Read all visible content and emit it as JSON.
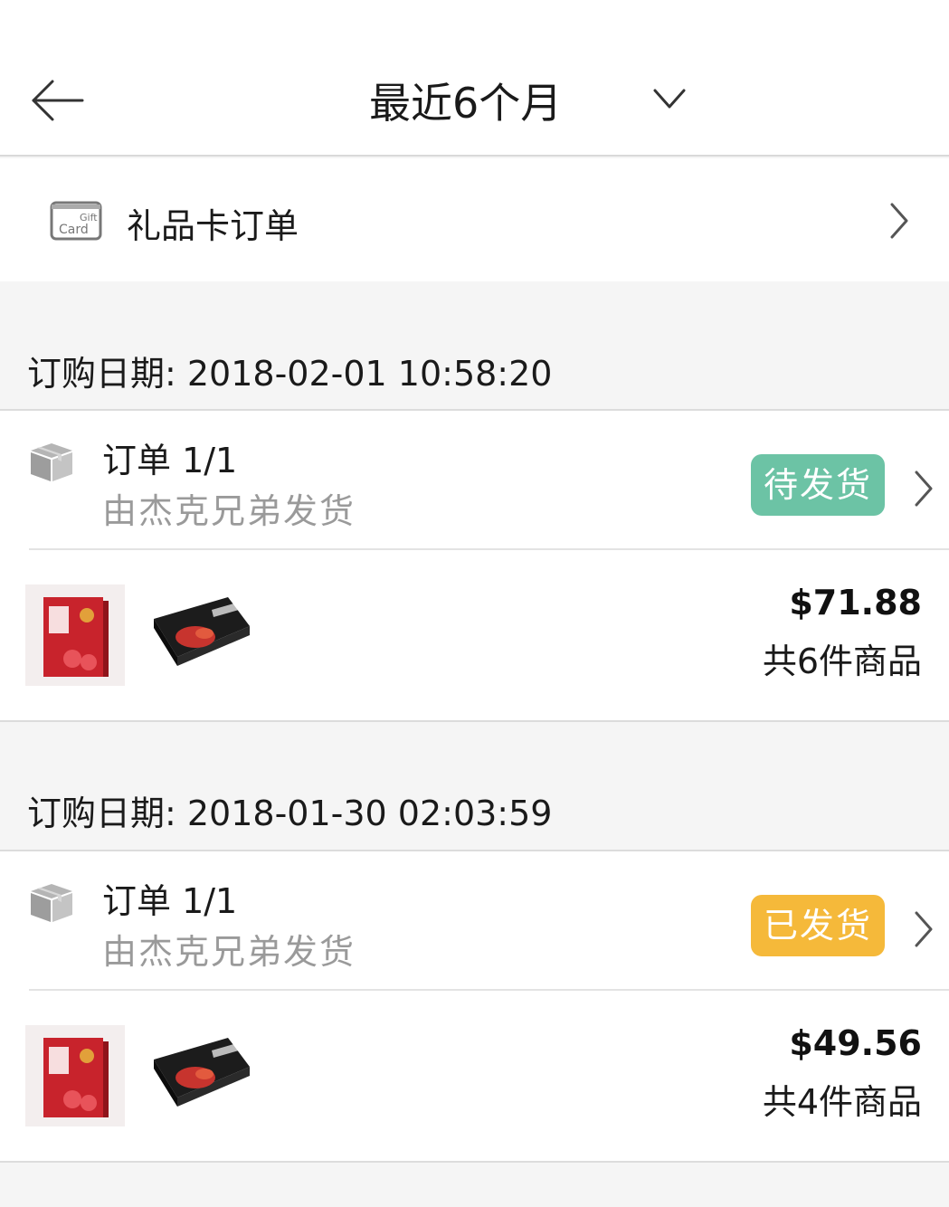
{
  "header": {
    "title": "最近6个月"
  },
  "gift_card": {
    "icon_text_top": "Gift",
    "icon_text_bottom": "Card",
    "label": "礼品卡订单"
  },
  "orders": [
    {
      "date_label": "订购日期: 2018-02-01 10:58:20",
      "title": "订单 1/1",
      "seller": "由杰克兄弟发货",
      "status": "待发货",
      "status_color": "#6cc3a5",
      "price": "$71.88",
      "count": "共6件商品"
    },
    {
      "date_label": "订购日期: 2018-01-30 02:03:59",
      "title": "订单 1/1",
      "seller": "由杰克兄弟发货",
      "status": "已发货",
      "status_color": "#f5b93a",
      "price": "$49.56",
      "count": "共4件商品"
    }
  ]
}
